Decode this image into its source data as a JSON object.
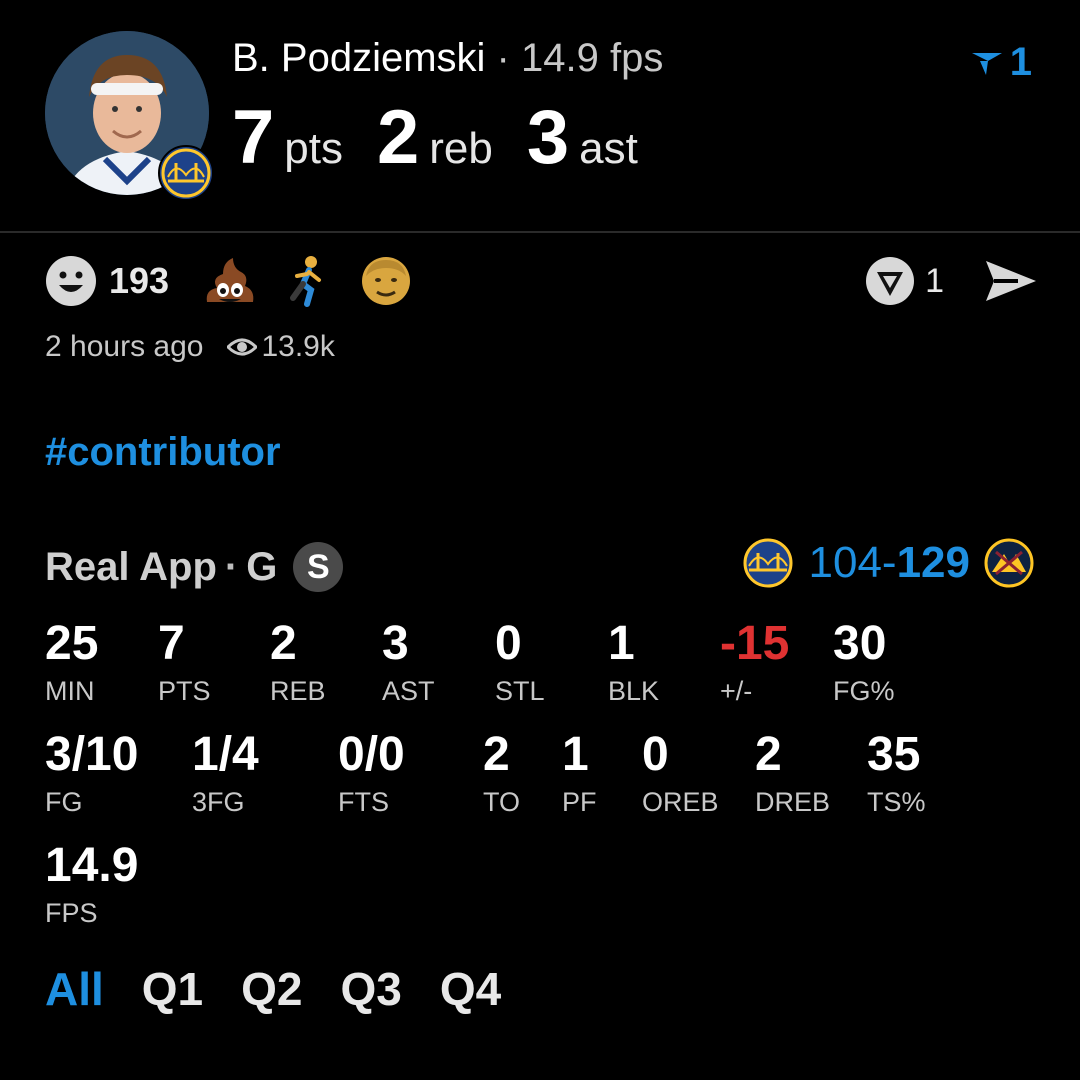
{
  "player": {
    "name": "B. Podziemski",
    "separator": "·",
    "fps_text": "14.9 fps",
    "pts": "7",
    "pts_label": "pts",
    "reb": "2",
    "reb_label": "reb",
    "ast": "3",
    "ast_label": "ast"
  },
  "filter_badge": {
    "count": "1",
    "icon": "filter-icon",
    "color": "#1e8fe0"
  },
  "reactions": {
    "smile_count": "193",
    "emojis": [
      "poop-emoji",
      "running-person-emoji",
      "old-person-emoji"
    ]
  },
  "actions": {
    "vote_count": "1",
    "icons": [
      "vote-icon",
      "send-icon"
    ]
  },
  "meta": {
    "time_ago": "2 hours ago",
    "views": "13.9k"
  },
  "hashtag": "#contributor",
  "game": {
    "source": "Real App",
    "separator": "·",
    "position": "G",
    "position_badge": "S",
    "score_home": "104",
    "score_sep": "-",
    "score_away": "129"
  },
  "stats_row1": [
    {
      "value": "25",
      "label": "MIN"
    },
    {
      "value": "7",
      "label": "PTS"
    },
    {
      "value": "2",
      "label": "REB"
    },
    {
      "value": "3",
      "label": "AST"
    },
    {
      "value": "0",
      "label": "STL"
    },
    {
      "value": "1",
      "label": "BLK"
    },
    {
      "value": "-15",
      "label": "+/-"
    },
    {
      "value": "30",
      "label": "FG%"
    }
  ],
  "stats_row2": [
    {
      "value": "3/10",
      "label": "FG"
    },
    {
      "value": "1/4",
      "label": "3FG"
    },
    {
      "value": "0/0",
      "label": "FTS"
    },
    {
      "value": "2",
      "label": "TO"
    },
    {
      "value": "1",
      "label": "PF"
    },
    {
      "value": "0",
      "label": "OREB"
    },
    {
      "value": "2",
      "label": "DREB"
    },
    {
      "value": "35",
      "label": "TS%"
    }
  ],
  "stats_row3": [
    {
      "value": "14.9",
      "label": "FPS"
    }
  ],
  "tabs": [
    {
      "label": "All",
      "active": true
    },
    {
      "label": "Q1"
    },
    {
      "label": "Q2"
    },
    {
      "label": "Q3"
    },
    {
      "label": "Q4"
    }
  ],
  "colors": {
    "accent": "#1e8fe0",
    "negative": "#e03232",
    "background": "#000000"
  }
}
